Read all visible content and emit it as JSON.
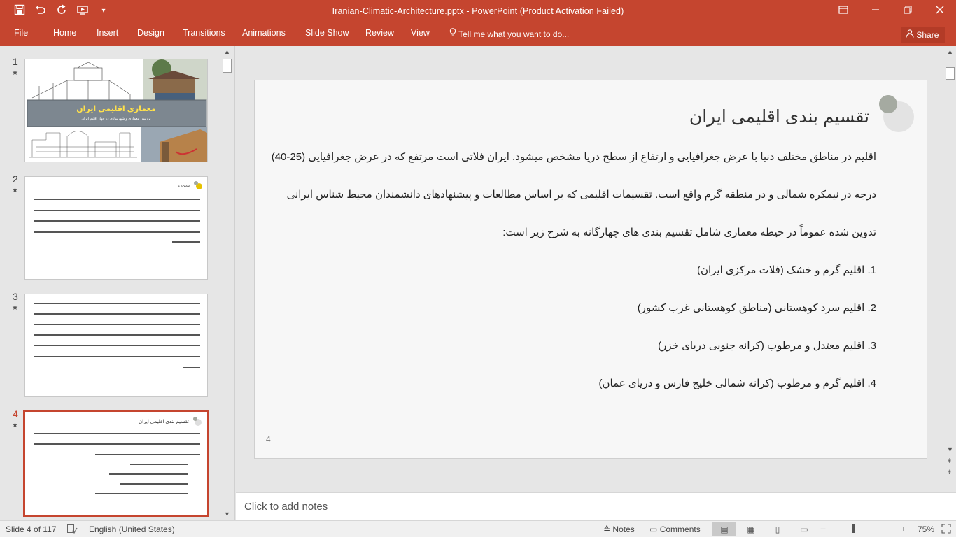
{
  "window": {
    "title": "Iranian-Climatic-Architecture.pptx - PowerPoint (Product Activation Failed)",
    "colors": {
      "accent": "#c5452f",
      "selected_border": "#c5452f"
    }
  },
  "qat": {
    "icons": [
      "save-icon",
      "undo-icon",
      "redo-icon",
      "start-from-beginning-icon",
      "customize-icon"
    ]
  },
  "ribbon": {
    "tabs": [
      "File",
      "Home",
      "Insert",
      "Design",
      "Transitions",
      "Animations",
      "Slide Show",
      "Review",
      "View"
    ],
    "tell_me": "Tell me what you want to do...",
    "share": "Share"
  },
  "thumbnails": [
    {
      "number": "1",
      "title": "معماری اقلیمی ایران",
      "subtitle": "بررسی معماری و شهرسازی در چهار اقلیم ایران"
    },
    {
      "number": "2",
      "title": "مقدمه"
    },
    {
      "number": "3"
    },
    {
      "number": "4",
      "title": "تقسیم بندی اقلیمی ایران",
      "selected": true
    }
  ],
  "slide": {
    "title": "تقسیم بندی اقلیمی ایران",
    "paragraphs": [
      "اقلیم در مناطق مختلف دنیا با عرض جغرافیایی و ارتفاع از سطح دریا مشخص میشود. ایران فلاتی است مرتفع که در عرض جغرافیایی (25-40)",
      "درجه در نیمکره شمالی و در منطقه گرم واقع است. تقسیمات اقلیمی که بر اساس مطالعات و پیشنهادهای دانشمندان محیط شناس ایرانی",
      "تدوین شده عموماً در حیطه معماری شامل تقسیم بندی های چهارگانه به شرح زیر است:"
    ],
    "list": [
      "1.   اقلیم گرم و خشک (فلات مرکزی ایران)",
      "2.   اقلیم سرد کوهستانی (مناطق کوهستانی غرب کشور)",
      "3.   اقلیم معتدل و مرطوب (کرانه جنوبی دریای خزر)",
      "4.   اقلیم گرم و مرطوب (کرانه شمالی خلیج فارس و دریای عمان)"
    ],
    "number": "4"
  },
  "notes": {
    "placeholder": "Click to add notes"
  },
  "status": {
    "slide_info": "Slide 4 of 117",
    "language": "English (United States)",
    "notes_label": "Notes",
    "comments_label": "Comments",
    "zoom": "75%"
  }
}
